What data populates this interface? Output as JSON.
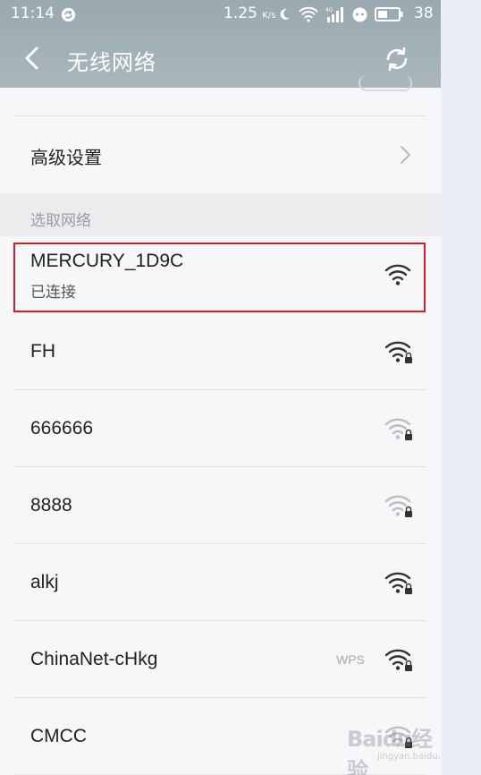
{
  "status_bar": {
    "time": "11:14",
    "speed": "1.25",
    "speed_unit": "K/s",
    "signal_label": "4G",
    "battery": "38"
  },
  "header": {
    "title": "无线网络"
  },
  "advanced": {
    "label": "高级设置"
  },
  "section": {
    "label": "选取网络"
  },
  "networks": [
    {
      "name": "MERCURY_1D9C",
      "status": "已连接",
      "locked": false,
      "strength": "strong",
      "wps": ""
    },
    {
      "name": "FH",
      "status": "",
      "locked": true,
      "strength": "strong",
      "wps": ""
    },
    {
      "name": "666666",
      "status": "",
      "locked": true,
      "strength": "weak",
      "wps": ""
    },
    {
      "name": "8888",
      "status": "",
      "locked": true,
      "strength": "weak",
      "wps": ""
    },
    {
      "name": "alkj",
      "status": "",
      "locked": true,
      "strength": "strong",
      "wps": ""
    },
    {
      "name": "ChinaNet-cHkg",
      "status": "",
      "locked": true,
      "strength": "strong",
      "wps": "WPS"
    },
    {
      "name": "CMCC",
      "status": "",
      "locked": true,
      "strength": "weak",
      "wps": ""
    }
  ],
  "watermark": {
    "brand": "Baidu经验",
    "url": "jingyan.baidu.com"
  },
  "colors": {
    "header_gradient_top": "#9aa8b0",
    "highlight_border": "#c7242a",
    "wifi_strong": "#333333",
    "wifi_weak": "#bdbdc2"
  }
}
